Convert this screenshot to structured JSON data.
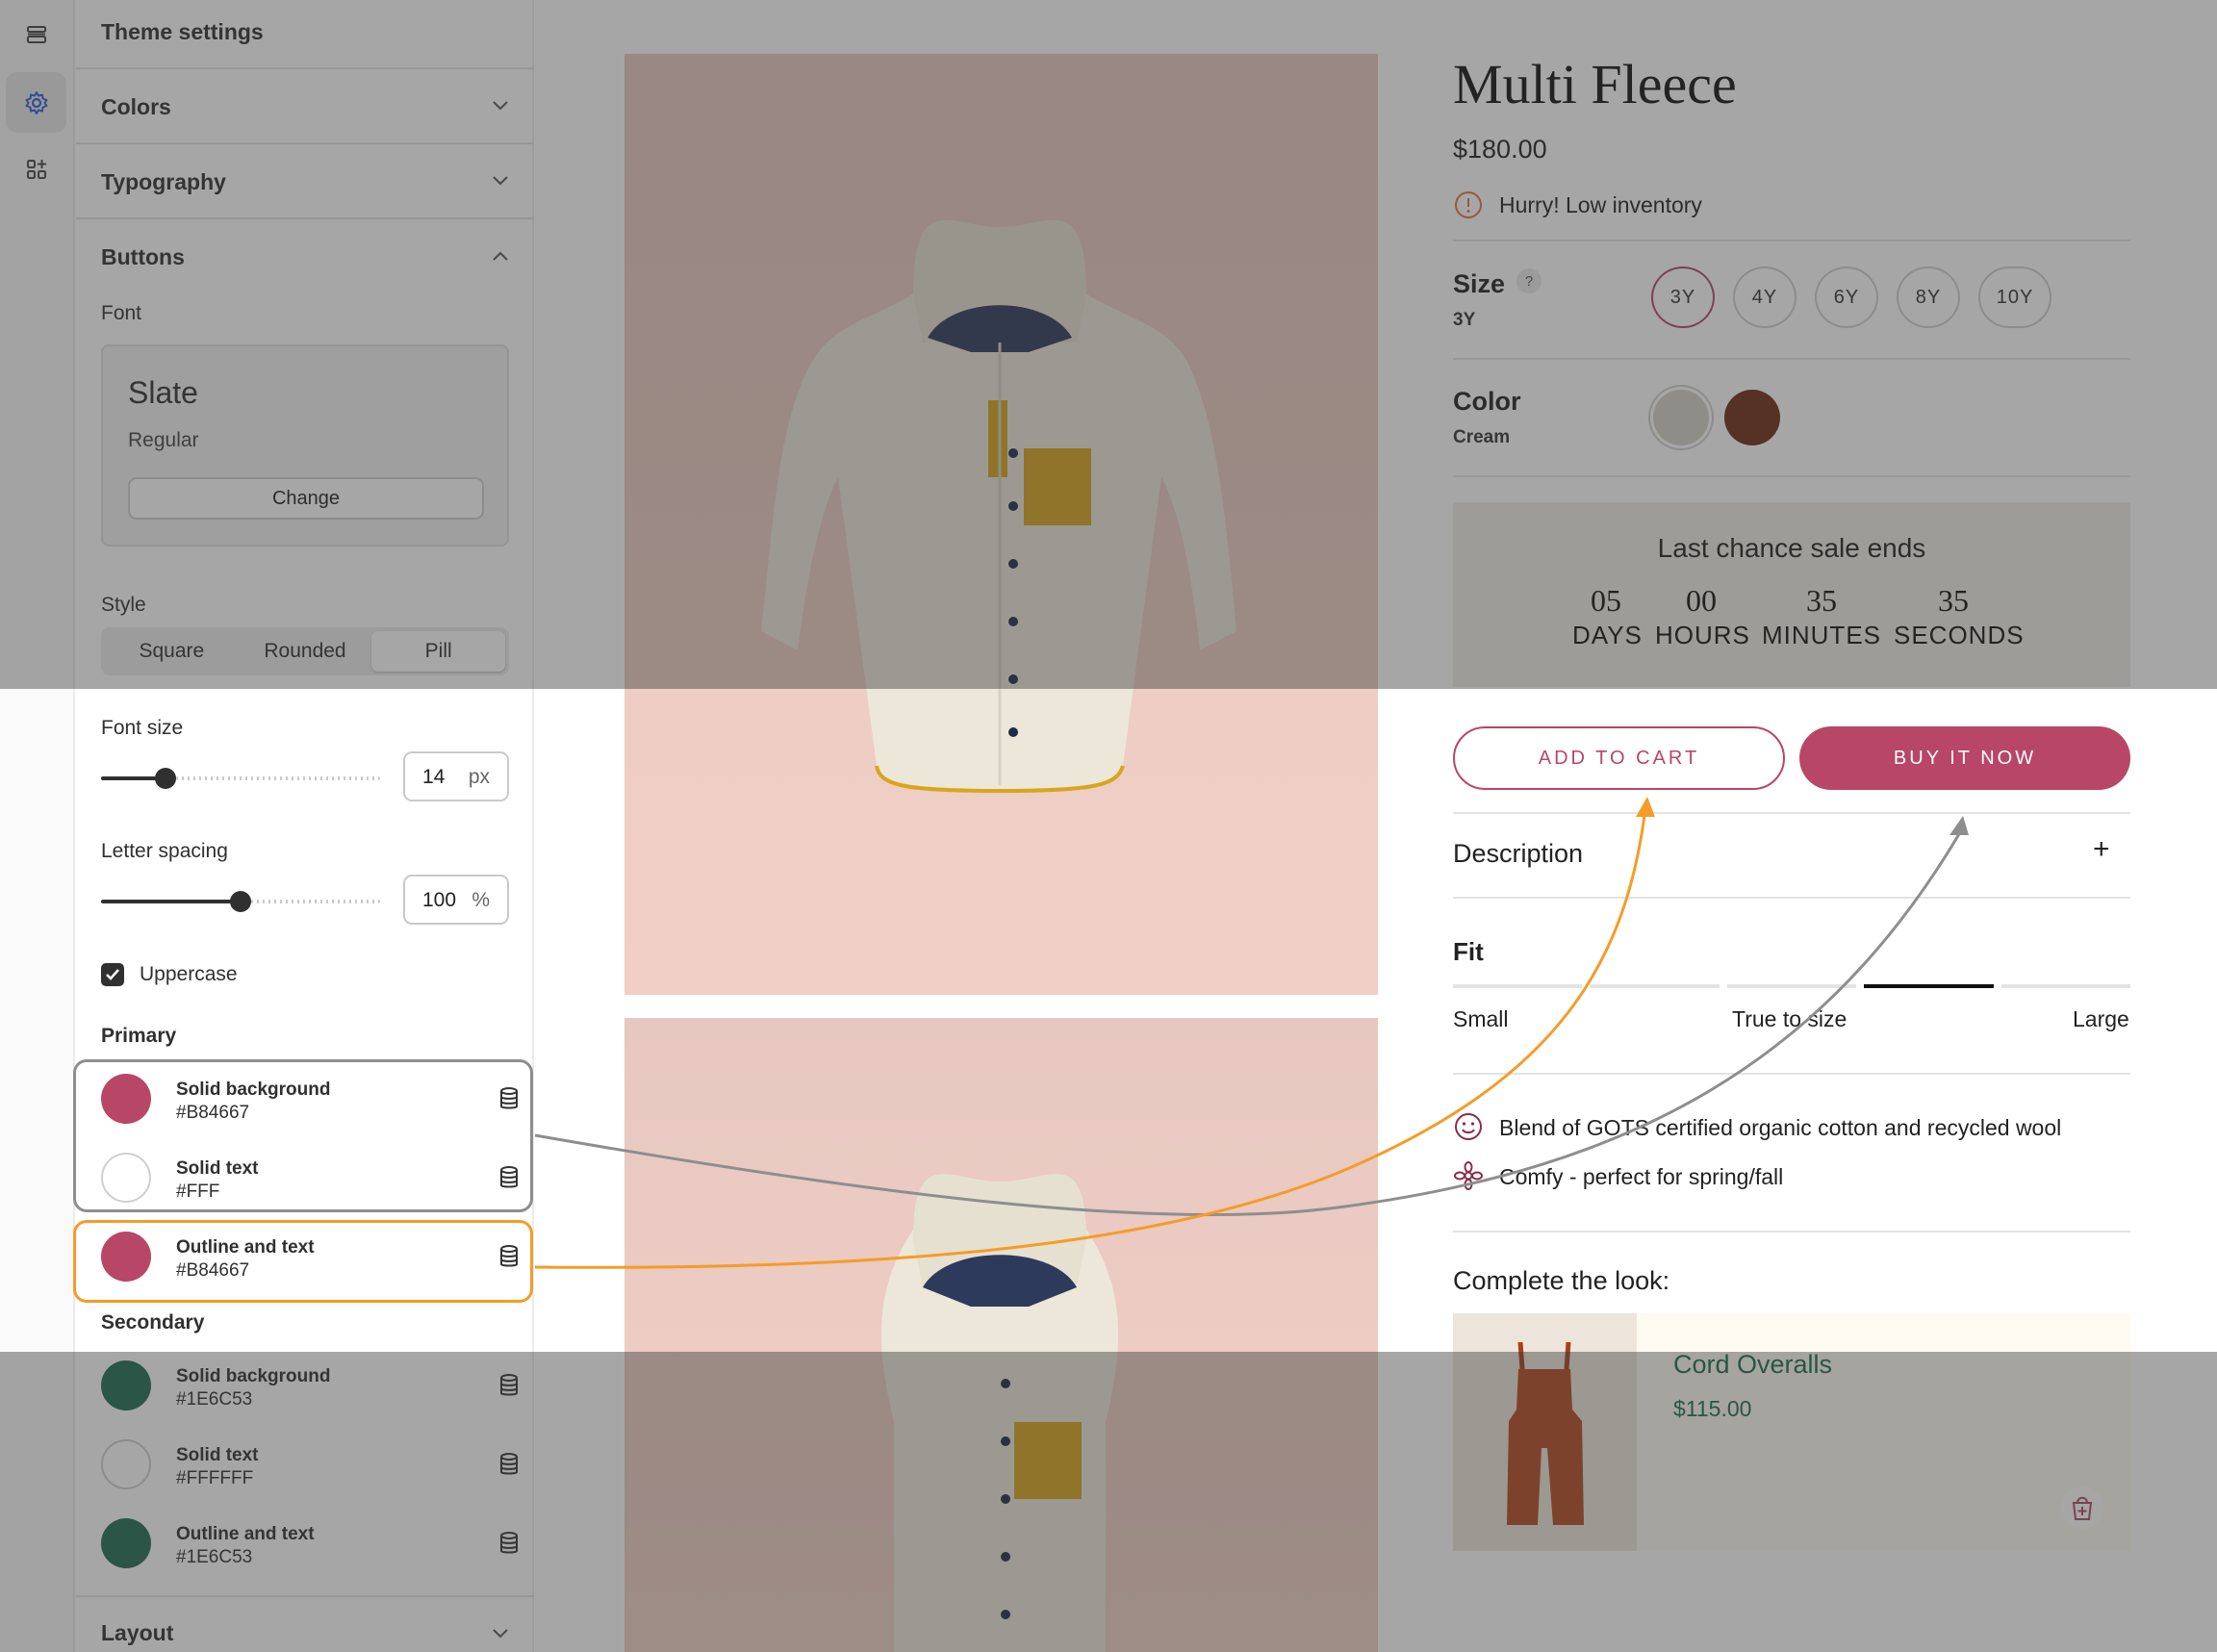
{
  "rail": {
    "icons": [
      "sections-icon",
      "gear-icon",
      "apps-icon"
    ],
    "active": "gear-icon"
  },
  "sidebar": {
    "title": "Theme settings",
    "sections": {
      "colors": "Colors",
      "typography": "Typography",
      "buttons": "Buttons",
      "layout": "Layout"
    },
    "font_label": "Font",
    "font": {
      "name": "Slate",
      "style": "Regular",
      "change": "Change"
    },
    "style_label": "Style",
    "style_options": [
      "Square",
      "Rounded",
      "Pill"
    ],
    "style_selected": "Pill",
    "font_size": {
      "label": "Font size",
      "value": "14",
      "unit": "px",
      "slider_fraction": 0.21
    },
    "letter_spacing": {
      "label": "Letter spacing",
      "value": "100",
      "unit": "%",
      "slider_fraction": 0.5
    },
    "uppercase": {
      "label": "Uppercase",
      "checked": true
    },
    "primary": {
      "label": "Primary",
      "items": [
        {
          "name": "Solid background",
          "hex": "#B84667",
          "color": "#b84667"
        },
        {
          "name": "Solid text",
          "hex": "#FFF",
          "color": "#ffffff"
        },
        {
          "name": "Outline and text",
          "hex": "#B84667",
          "color": "#b84667"
        }
      ]
    },
    "secondary": {
      "label": "Secondary",
      "items": [
        {
          "name": "Solid background",
          "hex": "#1E6C53",
          "color": "#1e6c53"
        },
        {
          "name": "Solid text",
          "hex": "#FFFFFF",
          "color": "#ffffff"
        },
        {
          "name": "Outline and text",
          "hex": "#1E6C53",
          "color": "#1e6c53"
        }
      ]
    }
  },
  "product": {
    "title": "Multi Fleece",
    "price": "$180.00",
    "inventory": "Hurry! Low inventory",
    "size": {
      "label": "Size",
      "help": "?",
      "selected": "3Y",
      "options": [
        "3Y",
        "4Y",
        "6Y",
        "8Y",
        "10Y"
      ]
    },
    "color": {
      "label": "Color",
      "selected": "Cream",
      "swatches": [
        "#d6d1c8",
        "#6e2b14"
      ]
    },
    "sale": {
      "title": "Last chance sale ends",
      "units": [
        {
          "value": "05",
          "label": "DAYS"
        },
        {
          "value": "00",
          "label": "HOURS"
        },
        {
          "value": "35",
          "label": "MINUTES"
        },
        {
          "value": "35",
          "label": "SECONDS"
        }
      ]
    },
    "add_to_cart": "ADD TO CART",
    "buy_now": "BUY IT NOW",
    "description": "Description",
    "expand": "+",
    "fit": {
      "label": "Fit",
      "small": "Small",
      "true": "True to size",
      "large": "Large",
      "active_segment": 3,
      "segments": 5
    },
    "features": [
      "Blend of GOTS certified organic cotton and recycled wool",
      "Comfy - perfect for spring/fall"
    ],
    "complete_look": "Complete the look:",
    "recommendation": {
      "name": "Cord Overalls",
      "price": "$115.00"
    }
  },
  "colors": {
    "primary": "#b84667",
    "secondary": "#1e6c53",
    "highlight_orange": "#f59c27",
    "highlight_gray": "#8e8e8e"
  }
}
